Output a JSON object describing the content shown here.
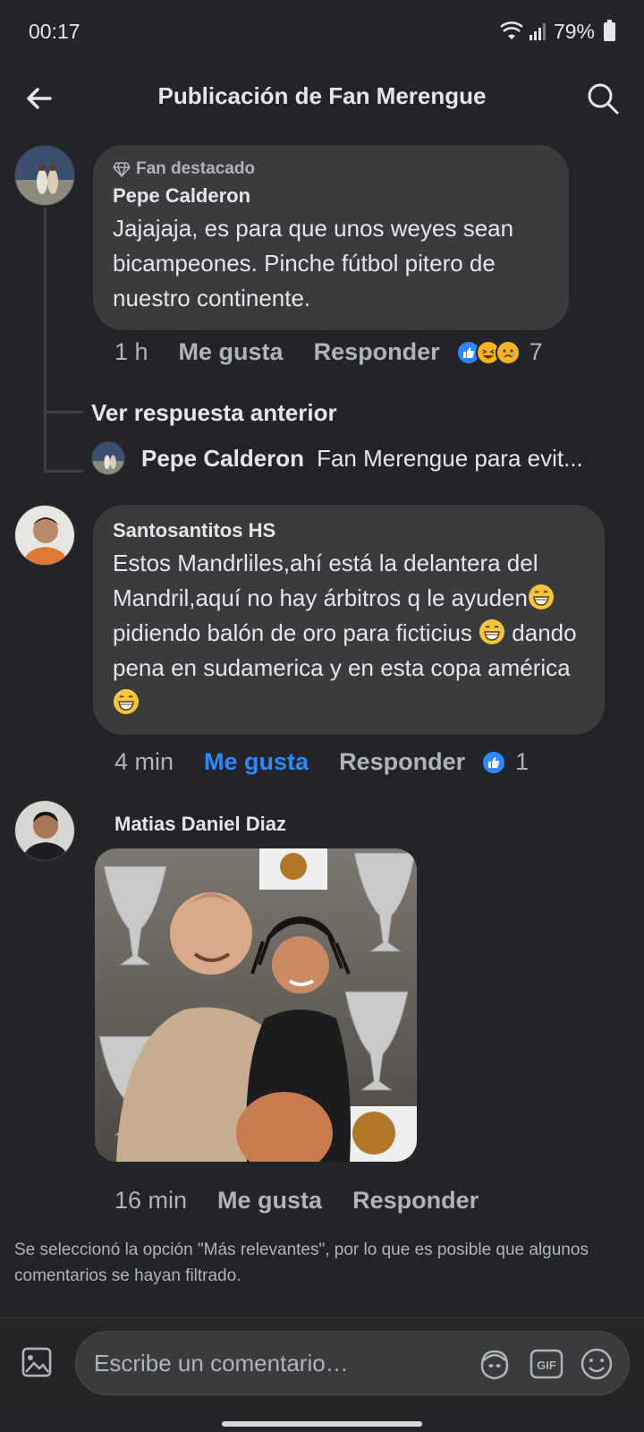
{
  "status_bar": {
    "time": "00:17",
    "battery": "79%"
  },
  "header": {
    "title": "Publicación de Fan Merengue"
  },
  "comments": [
    {
      "badge": "Fan destacado",
      "author": "Pepe Calderon",
      "text": "Jajajaja, es para que unos weyes sean bicampeones. Pinche fútbol pitero de nuestro continente.",
      "time": "1 h",
      "like_label": "Me gusta",
      "reply_label": "Responder",
      "reactions": [
        "like-icon",
        "haha-icon",
        "sad-icon"
      ],
      "reaction_count": "7"
    },
    {
      "author": "Santosantitos HS",
      "text_parts": [
        "Estos Mandrliles,ahí está la delantera del Mandril,aquí no hay árbitros q le ayuden",
        "pidiendo balón de oro para ficticius ",
        " dando pena en sudamerica y en esta copa américa "
      ],
      "time": "4 min",
      "like_label": "Me gusta",
      "reply_label": "Responder",
      "reactions": [
        "like-icon"
      ],
      "reaction_count": "1"
    },
    {
      "author": "Matias Daniel Diaz",
      "time": "16 min",
      "like_label": "Me gusta",
      "reply_label": "Responder"
    }
  ],
  "thread": {
    "view_previous": "Ver respuesta anterior",
    "reply_author": "Pepe Calderon",
    "reply_snippet": "Fan Merengue para evit..."
  },
  "filter_note": "Se seleccionó la opción \"Más relevantes\", por lo que es posible que algunos comentarios se hayan filtrado.",
  "composer": {
    "placeholder": "Escribe un comentario…",
    "gif_label": "GIF"
  },
  "colors": {
    "background": "#232427",
    "bubble": "#3a3b3d",
    "accent": "#2d88ff",
    "muted": "#b0b3b8"
  }
}
